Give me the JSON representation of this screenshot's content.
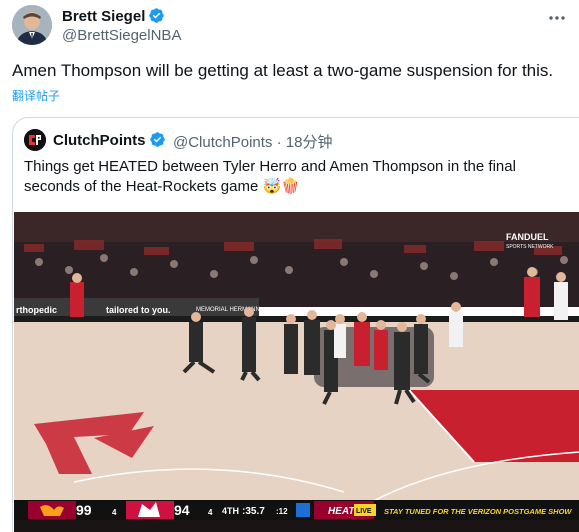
{
  "tweet": {
    "author_name": "Brett Siegel",
    "author_handle": "@BrettSiegelNBA",
    "text": "Amen Thompson will be getting at least a two-game suspension for this.",
    "translate_label": "翻译帖子"
  },
  "quote": {
    "author_name": "ClutchPoints",
    "author_handle": "@ClutchPoints",
    "time": "18分钟",
    "text_line1": "Things get HEATED between Tyler Herro and Amen Thompson in the final",
    "text_line2": "seconds of the Heat-Rockets game 🤯🍿"
  },
  "video": {
    "broadcaster": "FANDUEL",
    "broadcaster_sub": "SPORTS NETWORK",
    "banner_left": "rthopedic",
    "banner_right": "tailored to you.",
    "banner_sponsor": "MEMORIAL HERMANN",
    "scoreboard": {
      "away_score": "99",
      "away_fouls": "4",
      "home_score": "94",
      "home_fouls": "4",
      "period": "4TH",
      "clock": ":35.7",
      "shot_clock": ":12",
      "network_tag": "HEAT",
      "live_tag": "LIVE",
      "ticker": "STAY TUNED FOR THE VERIZON POSTGAME SHOW"
    }
  },
  "colors": {
    "accent_blue": "#1d9bf0",
    "heat_red": "#98002e",
    "rockets_red": "#ce1141",
    "court_wood": "#e6d3c4"
  },
  "icons": {
    "verified": "verified-badge-icon",
    "more": "more-options-icon"
  }
}
